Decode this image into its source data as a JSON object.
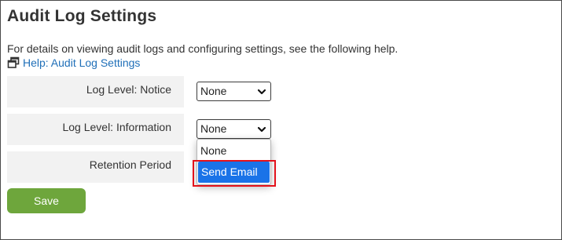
{
  "page": {
    "title": "Audit Log Settings",
    "description": "For details on viewing audit logs and configuring settings, see the following help.",
    "help_link": {
      "label": "Help: Audit Log Settings",
      "icon": "windows-icon"
    }
  },
  "settings": {
    "rows": [
      {
        "label": "Log Level: Notice",
        "selected": "None"
      },
      {
        "label": "Log Level: Information",
        "selected": "None"
      },
      {
        "label": "Retention Period"
      }
    ]
  },
  "dropdown": {
    "open_for": "Log Level: Information",
    "options": [
      "None",
      "Send Email"
    ],
    "highlighted_option": "Send Email"
  },
  "actions": {
    "save_label": "Save"
  },
  "colors": {
    "link": "#1f6fb8",
    "save_button": "#6ea63c",
    "highlight": "#1a73e8",
    "annotation_box": "#e3121b",
    "label_background": "#f2f2f2"
  }
}
